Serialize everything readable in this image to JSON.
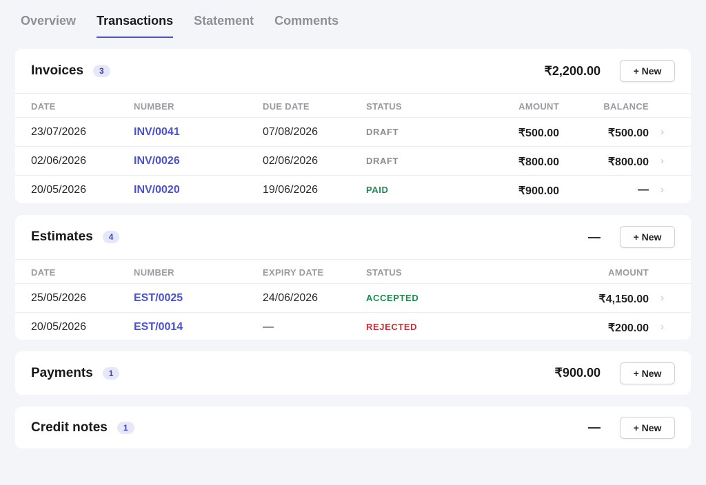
{
  "tabs": [
    {
      "label": "Overview",
      "active": false
    },
    {
      "label": "Transactions",
      "active": true
    },
    {
      "label": "Statement",
      "active": false
    },
    {
      "label": "Comments",
      "active": false
    }
  ],
  "invoices": {
    "title": "Invoices",
    "count": "3",
    "total": "₹2,200.00",
    "new_label": "+ New",
    "columns": [
      "DATE",
      "NUMBER",
      "DUE DATE",
      "STATUS",
      "AMOUNT",
      "BALANCE"
    ],
    "rows": [
      {
        "date": "23/07/2026",
        "number": "INV/0041",
        "due": "07/08/2026",
        "status": "DRAFT",
        "amount": "₹500.00",
        "balance": "₹500.00"
      },
      {
        "date": "02/06/2026",
        "number": "INV/0026",
        "due": "02/06/2026",
        "status": "DRAFT",
        "amount": "₹800.00",
        "balance": "₹800.00"
      },
      {
        "date": "20/05/2026",
        "number": "INV/0020",
        "due": "19/06/2026",
        "status": "PAID",
        "amount": "₹900.00",
        "balance": "—"
      }
    ]
  },
  "estimates": {
    "title": "Estimates",
    "count": "4",
    "total": "—",
    "new_label": "+ New",
    "columns": [
      "DATE",
      "NUMBER",
      "EXPIRY DATE",
      "STATUS",
      "AMOUNT"
    ],
    "rows": [
      {
        "date": "25/05/2026",
        "number": "EST/0025",
        "expiry": "24/06/2026",
        "status": "ACCEPTED",
        "amount": "₹4,150.00"
      },
      {
        "date": "20/05/2026",
        "number": "EST/0014",
        "expiry": "—",
        "status": "REJECTED",
        "amount": "₹200.00"
      }
    ]
  },
  "payments": {
    "title": "Payments",
    "count": "1",
    "total": "₹900.00",
    "new_label": "+ New"
  },
  "credit_notes": {
    "title": "Credit notes",
    "count": "1",
    "total": "—",
    "new_label": "+ New"
  },
  "icons": {
    "row_chevron": "chevron-right-icon",
    "chevron_glyph": "›"
  },
  "colors": {
    "accent": "#4b51d6",
    "paid": "#1f8a4c",
    "rejected": "#c3323a",
    "draft": "#8b8c92"
  }
}
